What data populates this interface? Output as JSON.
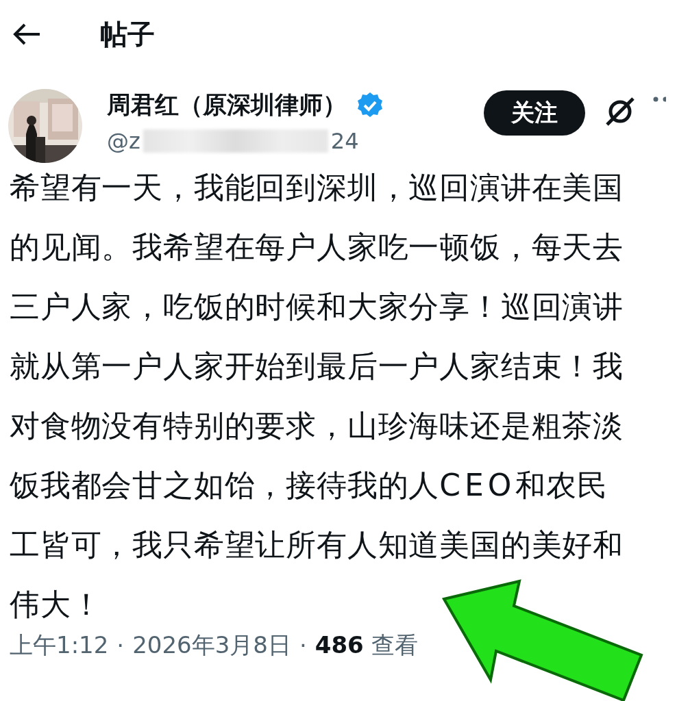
{
  "header": {
    "title": "帖子"
  },
  "author": {
    "name": "周君红（原深圳律师）",
    "verified": true,
    "handle_start": "@z",
    "handle_end": "24"
  },
  "follow_button": {
    "label": "关注"
  },
  "post": {
    "text": "希望有一天，我能回到深圳，巡回演讲在美国的见闻。我希望在每户人家吃一顿饭，每天去三户人家，吃饭的时候和大家分享！巡回演讲就从第一户人家开始到最后一户人家结束！我对食物没有特别的要求，山珍海味还是粗茶淡饭我都会甘之如饴，接待我的人CEO和农民工皆可，我只希望让所有人知道美国的美好和伟大！"
  },
  "meta": {
    "time": "上午1:12",
    "separator_1": "·",
    "date": "2026年3月8日",
    "separator_2": "·",
    "views": "**486** 查看"
  }
}
